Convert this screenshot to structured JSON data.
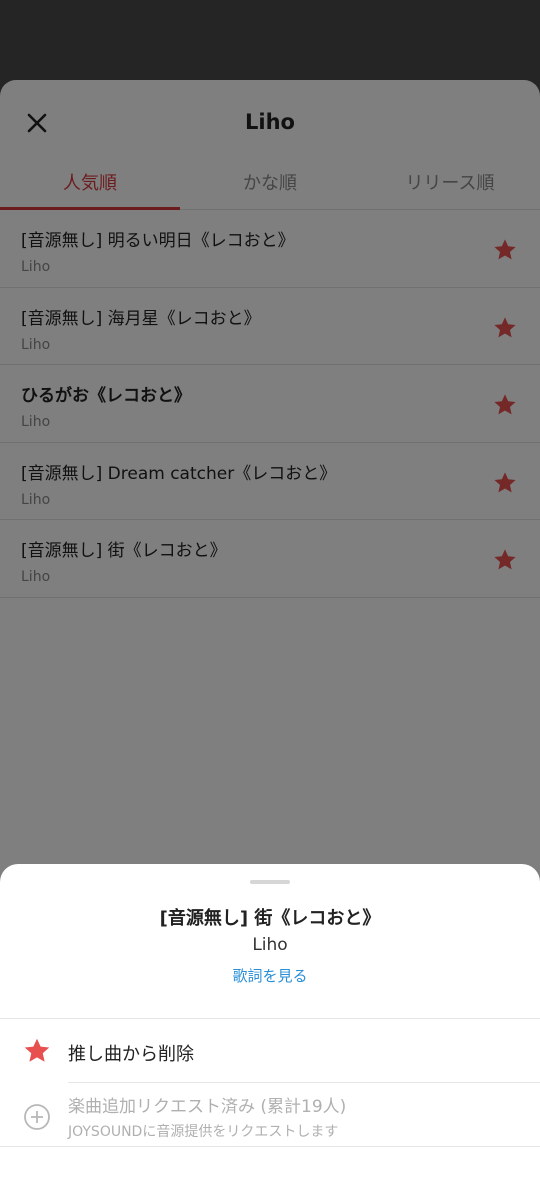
{
  "colors": {
    "accent": "#d8383f",
    "star": "#e85050",
    "link": "#2a8fd6"
  },
  "panel": {
    "title": "Liho",
    "close_icon": "close-icon",
    "tabs": [
      {
        "label": "人気順",
        "active": true
      },
      {
        "label": "かな順",
        "active": false
      },
      {
        "label": "リリース順",
        "active": false
      }
    ],
    "songs": [
      {
        "title": "[音源無し] 明るい明日《レコおと》",
        "artist": "Liho",
        "bold": false,
        "starred": true
      },
      {
        "title": "[音源無し] 海月星《レコおと》",
        "artist": "Liho",
        "bold": false,
        "starred": true
      },
      {
        "title": "ひるがお《レコおと》",
        "artist": "Liho",
        "bold": true,
        "starred": true
      },
      {
        "title": "[音源無し] Dream catcher《レコおと》",
        "artist": "Liho",
        "bold": false,
        "starred": true
      },
      {
        "title": "[音源無し] 街《レコおと》",
        "artist": "Liho",
        "bold": false,
        "starred": true
      }
    ]
  },
  "sheet": {
    "title": "[音源無し] 街《レコおと》",
    "artist": "Liho",
    "lyrics_link": "歌詞を見る",
    "favorite_action": "推し曲から削除",
    "request_action": "楽曲追加リクエスト済み (累計19人)",
    "request_sub": "JOYSOUNDに音源提供をリクエストします"
  }
}
